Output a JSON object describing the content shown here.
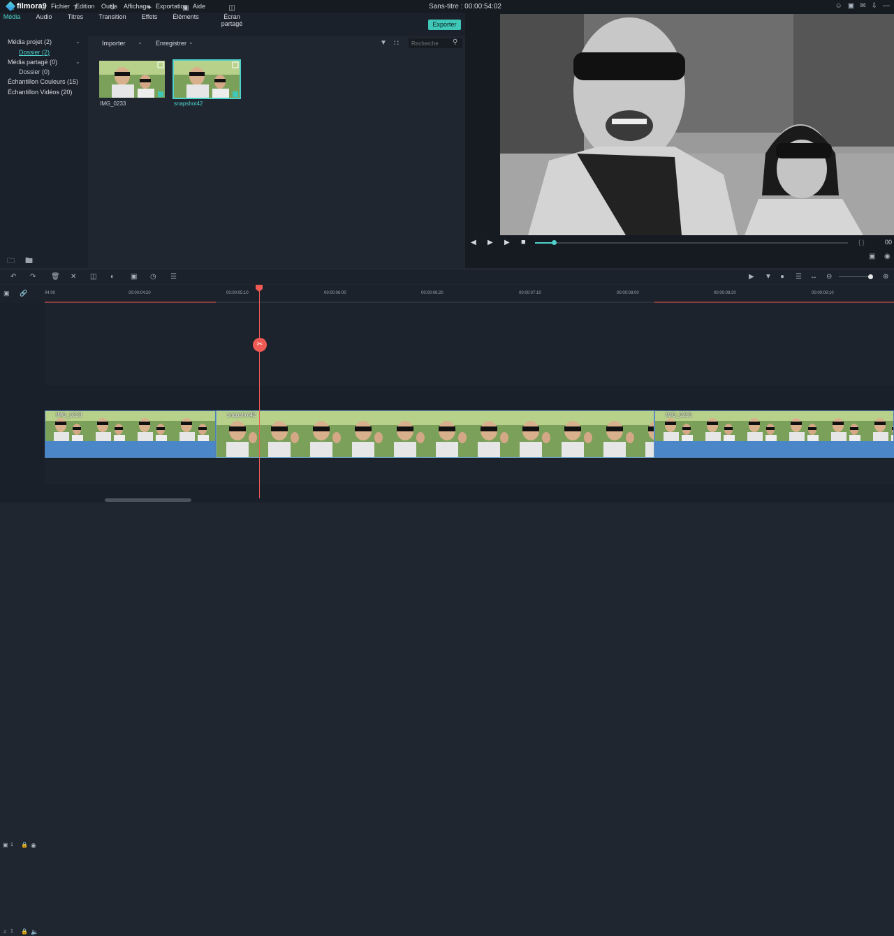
{
  "app": {
    "name": "filmora9",
    "doc_title": "Sans-titre : 00:00:54:02"
  },
  "menu": [
    "Fichier",
    "Edition",
    "Outils",
    "Affichage",
    "Exportation",
    "Aide"
  ],
  "tabs": [
    {
      "label": "Média",
      "icon": "folder-icon"
    },
    {
      "label": "Audio",
      "icon": "music-note-icon"
    },
    {
      "label": "Titres",
      "icon": "text-icon"
    },
    {
      "label": "Transition",
      "icon": "transition-icon"
    },
    {
      "label": "Effets",
      "icon": "effects-icon"
    },
    {
      "label": "Éléments",
      "icon": "image-icon"
    },
    {
      "label": "Écran partagé",
      "icon": "split-screen-icon"
    }
  ],
  "export_label": "Exporter",
  "tree": {
    "project_media": "Média projet (2)",
    "project_folder": "Dossier (2)",
    "shared_media": "Média partagé (0)",
    "shared_folder": "Dossier (0)",
    "color_samples": "Échantillon Couleurs (15)",
    "video_samples": "Échantillon Vidéos (20)"
  },
  "media_toolbar": {
    "import": "Importer",
    "save": "Enregistrer",
    "search_placeholder": "Recherche"
  },
  "media_items": [
    {
      "name": "IMG_0233",
      "selected": false
    },
    {
      "name": "snapshot42",
      "selected": true
    }
  ],
  "ruler_ticks": [
    "04:00",
    "00:00:04:20",
    "00:00:05:10",
    "00:00:06:00",
    "00:00:06:20",
    "00:00:07:10",
    "00:00:08:00",
    "00:00:08:20",
    "00:00:09:10"
  ],
  "preview_time_fragment": "00",
  "tracks": {
    "video_track": "1",
    "audio_track": "1",
    "clips": [
      {
        "label": "IMG_0233"
      },
      {
        "label": "snapshot42"
      },
      {
        "label": "IMG_0233"
      }
    ]
  },
  "preview": {
    "progress": 0.06
  },
  "colors": {
    "accent": "#4fd2cc",
    "playhead": "#f05a55",
    "export": "#3fc8b8"
  }
}
